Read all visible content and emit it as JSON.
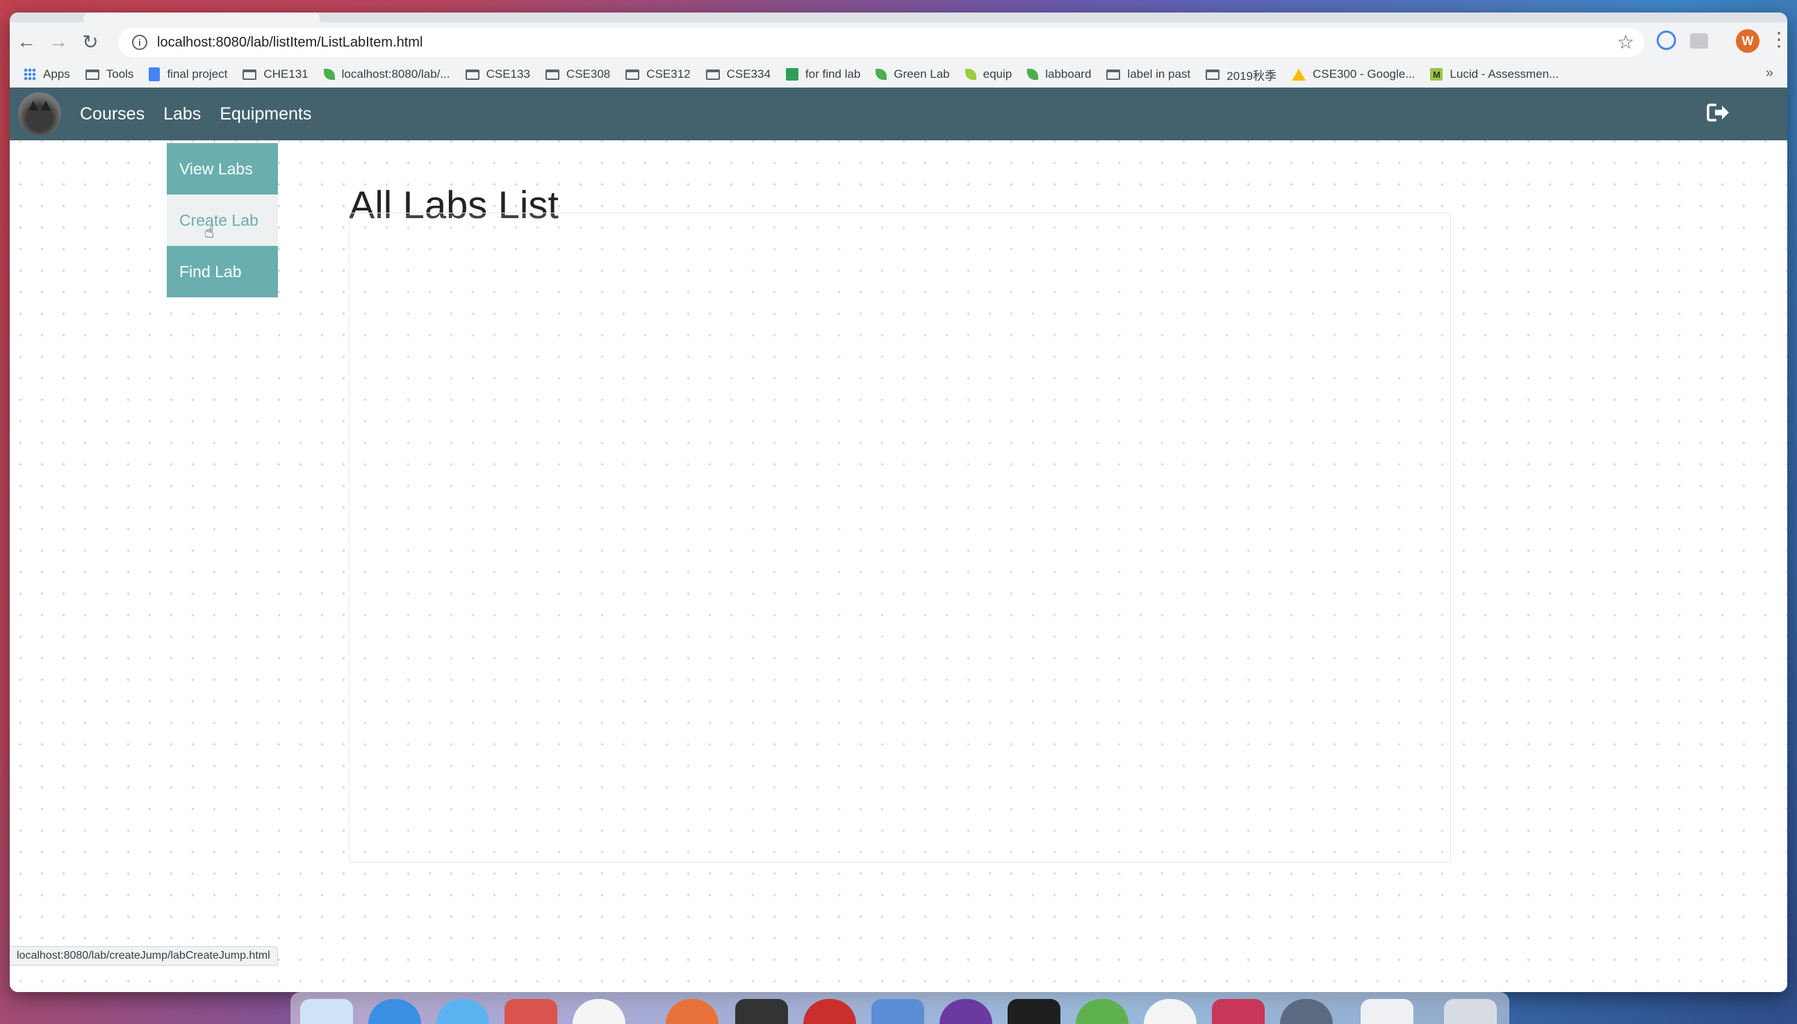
{
  "browser": {
    "url": "localhost:8080/lab/listItem/ListLabItem.html",
    "profile_initial": "W",
    "status_url": "localhost:8080/lab/createJump/labCreateJump.html",
    "bookmarks": [
      {
        "label": "Apps",
        "icon": "apps-icon"
      },
      {
        "label": "Tools",
        "icon": "folder-icon"
      },
      {
        "label": "final project",
        "icon": "doc-icon"
      },
      {
        "label": "CHE131",
        "icon": "folder-icon"
      },
      {
        "label": "localhost:8080/lab/...",
        "icon": "leaf-icon"
      },
      {
        "label": "CSE133",
        "icon": "folder-icon"
      },
      {
        "label": "CSE308",
        "icon": "folder-icon"
      },
      {
        "label": "CSE312",
        "icon": "folder-icon"
      },
      {
        "label": "CSE334",
        "icon": "folder-icon"
      },
      {
        "label": "for find lab",
        "icon": "green-square-icon"
      },
      {
        "label": "Green Lab",
        "icon": "leaf-icon"
      },
      {
        "label": "equip",
        "icon": "yellow-leaf-icon"
      },
      {
        "label": "labboard",
        "icon": "leaf-icon"
      },
      {
        "label": "label in past",
        "icon": "folder-icon"
      },
      {
        "label": "2019秋季",
        "icon": "folder-icon"
      },
      {
        "label": "CSE300 - Google...",
        "icon": "drive-icon"
      },
      {
        "label": "Lucid - Assessmen...",
        "icon": "lucid-icon"
      }
    ],
    "bookmarks_more": "»"
  },
  "app": {
    "nav": {
      "courses": "Courses",
      "labs": "Labs",
      "equipments": "Equipments"
    },
    "labs_menu": {
      "view": "View Labs",
      "create": "Create Lab",
      "find": "Find Lab"
    },
    "page_title": "All Labs List"
  },
  "colors": {
    "navbar": "#43626e",
    "menu_teal": "#6aaeb0"
  }
}
